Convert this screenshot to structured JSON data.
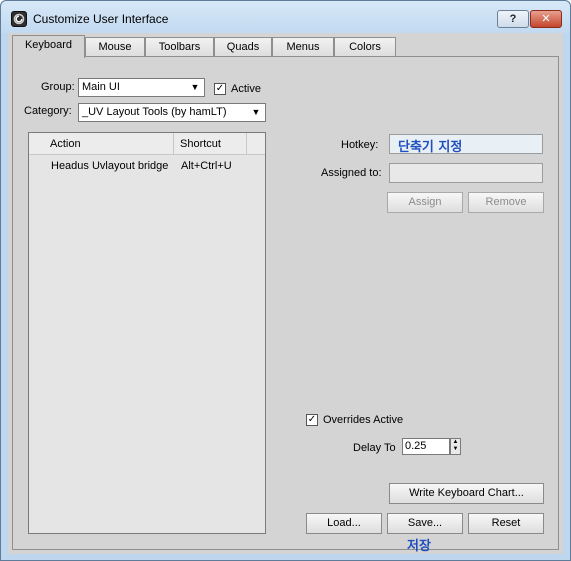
{
  "window": {
    "title": "Customize User Interface",
    "help_label": "?",
    "close_label": "✕"
  },
  "tabs": [
    {
      "label": "Keyboard",
      "active": true
    },
    {
      "label": "Mouse"
    },
    {
      "label": "Toolbars"
    },
    {
      "label": "Quads"
    },
    {
      "label": "Menus"
    },
    {
      "label": "Colors"
    }
  ],
  "keyboard": {
    "group_label": "Group:",
    "group_value": "Main UI",
    "active_label": "Active",
    "active_checked": true,
    "category_label": "Category:",
    "category_value": "_UV Layout Tools (by hamLT)",
    "list": {
      "columns": [
        "Action",
        "Shortcut"
      ],
      "rows": [
        {
          "action": "Headus Uvlayout bridge",
          "shortcut": "Alt+Ctrl+U"
        }
      ]
    },
    "hotkey_label": "Hotkey:",
    "hotkey_note": "단축기 지정",
    "assigned_label": "Assigned to:",
    "assign_button": "Assign",
    "remove_button": "Remove",
    "overrides_label": "Overrides Active",
    "overrides_checked": true,
    "delay_label": "Delay To",
    "delay_value": "0.25",
    "write_chart_button": "Write Keyboard Chart...",
    "load_button": "Load...",
    "save_button": "Save...",
    "reset_button": "Reset",
    "save_note": "저장"
  },
  "icons": {
    "app": "3dsmax-app-icon",
    "check": "✓",
    "dropdown": "▼"
  }
}
